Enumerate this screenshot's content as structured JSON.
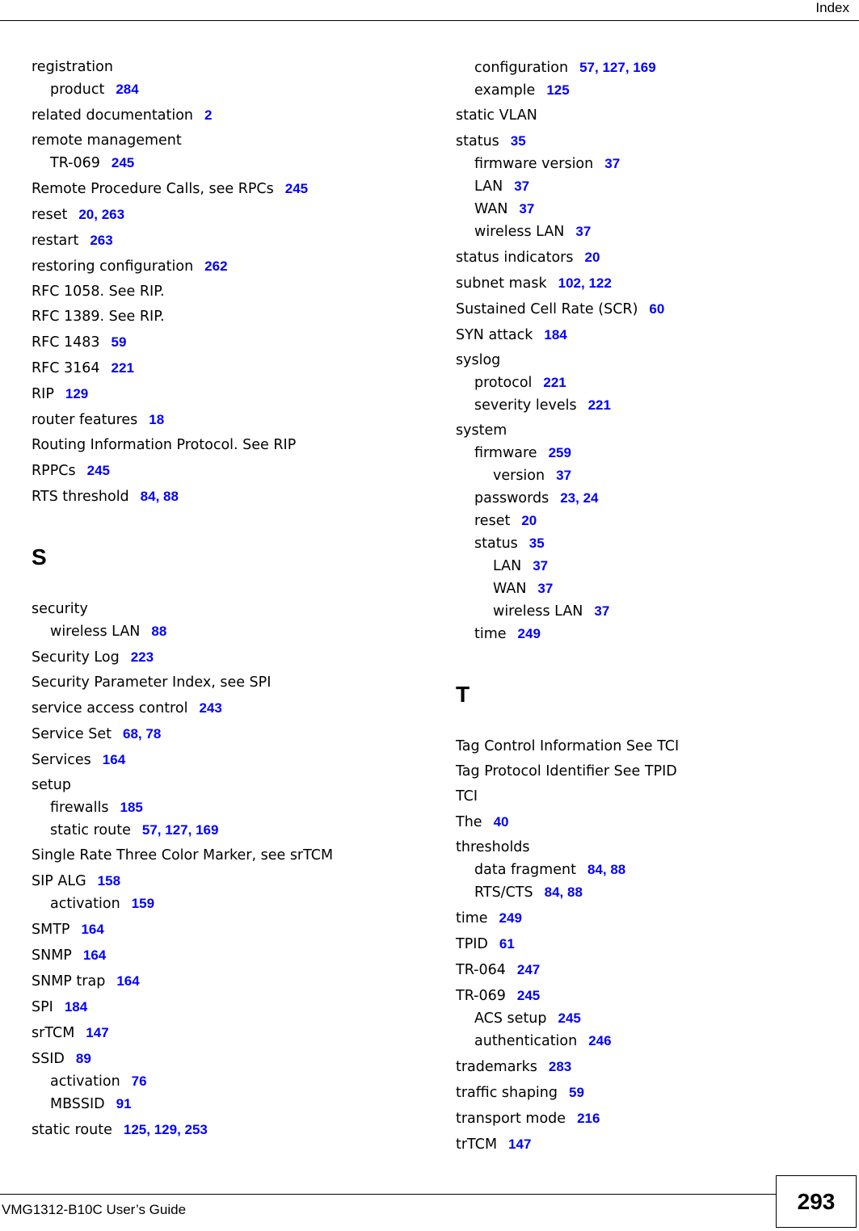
{
  "header": {
    "title": "Index"
  },
  "footer": {
    "guide_title": "VMG1312-B10C User’s Guide",
    "page_number": "293"
  },
  "colors": {
    "page_link": "#0000ff",
    "text": "#000000"
  },
  "columns": [
    {
      "blocks": [
        {
          "type": "entry",
          "level": 0,
          "text": "registration",
          "pages": []
        },
        {
          "type": "entry",
          "level": 1,
          "text": "product",
          "pages": [
            "284"
          ]
        },
        {
          "type": "entry",
          "level": 0,
          "text": "related documentation",
          "pages": [
            "2"
          ]
        },
        {
          "type": "entry",
          "level": 0,
          "text": "remote management",
          "pages": []
        },
        {
          "type": "entry",
          "level": 1,
          "text": "TR-069",
          "pages": [
            "245"
          ]
        },
        {
          "type": "entry",
          "level": 0,
          "text": "Remote Procedure Calls, see RPCs",
          "pages": [
            "245"
          ]
        },
        {
          "type": "entry",
          "level": 0,
          "text": "reset",
          "pages": [
            "20",
            "263"
          ]
        },
        {
          "type": "entry",
          "level": 0,
          "text": "restart",
          "pages": [
            "263"
          ]
        },
        {
          "type": "entry",
          "level": 0,
          "text": "restoring configuration",
          "pages": [
            "262"
          ]
        },
        {
          "type": "entry",
          "level": 0,
          "text": "RFC 1058. See RIP.",
          "pages": []
        },
        {
          "type": "entry",
          "level": 0,
          "text": "RFC 1389. See RIP.",
          "pages": []
        },
        {
          "type": "entry",
          "level": 0,
          "text": "RFC 1483",
          "pages": [
            "59"
          ]
        },
        {
          "type": "entry",
          "level": 0,
          "text": "RFC 3164",
          "pages": [
            "221"
          ]
        },
        {
          "type": "entry",
          "level": 0,
          "text": "RIP",
          "pages": [
            "129"
          ]
        },
        {
          "type": "entry",
          "level": 0,
          "text": "router features",
          "pages": [
            "18"
          ]
        },
        {
          "type": "entry",
          "level": 0,
          "text": "Routing Information Protocol. See RIP",
          "pages": []
        },
        {
          "type": "entry",
          "level": 0,
          "text": "RPPCs",
          "pages": [
            "245"
          ]
        },
        {
          "type": "entry",
          "level": 0,
          "text": "RTS threshold",
          "pages": [
            "84",
            "88"
          ]
        },
        {
          "type": "letter",
          "text": "S"
        },
        {
          "type": "entry",
          "level": 0,
          "text": "security",
          "pages": []
        },
        {
          "type": "entry",
          "level": 1,
          "text": "wireless LAN",
          "pages": [
            "88"
          ]
        },
        {
          "type": "entry",
          "level": 0,
          "text": "Security Log",
          "pages": [
            "223"
          ]
        },
        {
          "type": "entry",
          "level": 0,
          "text": "Security Parameter Index, see SPI",
          "pages": []
        },
        {
          "type": "entry",
          "level": 0,
          "text": "service access control",
          "pages": [
            "243"
          ]
        },
        {
          "type": "entry",
          "level": 0,
          "text": "Service Set",
          "pages": [
            "68",
            "78"
          ]
        },
        {
          "type": "entry",
          "level": 0,
          "text": "Services",
          "pages": [
            "164"
          ]
        },
        {
          "type": "entry",
          "level": 0,
          "text": "setup",
          "pages": []
        },
        {
          "type": "entry",
          "level": 1,
          "text": "firewalls",
          "pages": [
            "185"
          ]
        },
        {
          "type": "entry",
          "level": 1,
          "text": "static route",
          "pages": [
            "57",
            "127",
            "169"
          ]
        },
        {
          "type": "entry",
          "level": 0,
          "text": "Single Rate Three Color Marker, see srTCM",
          "pages": []
        },
        {
          "type": "entry",
          "level": 0,
          "text": "SIP ALG",
          "pages": [
            "158"
          ]
        },
        {
          "type": "entry",
          "level": 1,
          "text": "activation",
          "pages": [
            "159"
          ]
        },
        {
          "type": "entry",
          "level": 0,
          "text": "SMTP",
          "pages": [
            "164"
          ]
        },
        {
          "type": "entry",
          "level": 0,
          "text": "SNMP",
          "pages": [
            "164"
          ]
        },
        {
          "type": "entry",
          "level": 0,
          "text": "SNMP trap",
          "pages": [
            "164"
          ]
        },
        {
          "type": "entry",
          "level": 0,
          "text": "SPI",
          "pages": [
            "184"
          ]
        },
        {
          "type": "entry",
          "level": 0,
          "text": "srTCM",
          "pages": [
            "147"
          ]
        },
        {
          "type": "entry",
          "level": 0,
          "text": "SSID",
          "pages": [
            "89"
          ]
        },
        {
          "type": "entry",
          "level": 1,
          "text": "activation",
          "pages": [
            "76"
          ]
        },
        {
          "type": "entry",
          "level": 1,
          "text": "MBSSID",
          "pages": [
            "91"
          ]
        },
        {
          "type": "entry",
          "level": 0,
          "text": "static route",
          "pages": [
            "125",
            "129",
            "253"
          ]
        }
      ]
    },
    {
      "blocks": [
        {
          "type": "entry",
          "level": 1,
          "text": "configuration",
          "pages": [
            "57",
            "127",
            "169"
          ]
        },
        {
          "type": "entry",
          "level": 1,
          "text": "example",
          "pages": [
            "125"
          ]
        },
        {
          "type": "entry",
          "level": 0,
          "text": "static VLAN",
          "pages": []
        },
        {
          "type": "entry",
          "level": 0,
          "text": "status",
          "pages": [
            "35"
          ]
        },
        {
          "type": "entry",
          "level": 1,
          "text": "firmware version",
          "pages": [
            "37"
          ]
        },
        {
          "type": "entry",
          "level": 1,
          "text": "LAN",
          "pages": [
            "37"
          ]
        },
        {
          "type": "entry",
          "level": 1,
          "text": "WAN",
          "pages": [
            "37"
          ]
        },
        {
          "type": "entry",
          "level": 1,
          "text": "wireless LAN",
          "pages": [
            "37"
          ]
        },
        {
          "type": "entry",
          "level": 0,
          "text": "status indicators",
          "pages": [
            "20"
          ]
        },
        {
          "type": "entry",
          "level": 0,
          "text": "subnet mask",
          "pages": [
            "102",
            "122"
          ]
        },
        {
          "type": "entry",
          "level": 0,
          "text": "Sustained Cell Rate (SCR)",
          "pages": [
            "60"
          ]
        },
        {
          "type": "entry",
          "level": 0,
          "text": "SYN attack",
          "pages": [
            "184"
          ]
        },
        {
          "type": "entry",
          "level": 0,
          "text": "syslog",
          "pages": []
        },
        {
          "type": "entry",
          "level": 1,
          "text": "protocol",
          "pages": [
            "221"
          ]
        },
        {
          "type": "entry",
          "level": 1,
          "text": "severity levels",
          "pages": [
            "221"
          ]
        },
        {
          "type": "entry",
          "level": 0,
          "text": "system",
          "pages": []
        },
        {
          "type": "entry",
          "level": 1,
          "text": "firmware",
          "pages": [
            "259"
          ]
        },
        {
          "type": "entry",
          "level": 2,
          "text": "version",
          "pages": [
            "37"
          ]
        },
        {
          "type": "entry",
          "level": 1,
          "text": "passwords",
          "pages": [
            "23",
            "24"
          ]
        },
        {
          "type": "entry",
          "level": 1,
          "text": "reset",
          "pages": [
            "20"
          ]
        },
        {
          "type": "entry",
          "level": 1,
          "text": "status",
          "pages": [
            "35"
          ]
        },
        {
          "type": "entry",
          "level": 2,
          "text": "LAN",
          "pages": [
            "37"
          ]
        },
        {
          "type": "entry",
          "level": 2,
          "text": "WAN",
          "pages": [
            "37"
          ]
        },
        {
          "type": "entry",
          "level": 2,
          "text": "wireless LAN",
          "pages": [
            "37"
          ]
        },
        {
          "type": "entry",
          "level": 1,
          "text": "time",
          "pages": [
            "249"
          ]
        },
        {
          "type": "letter",
          "text": "T"
        },
        {
          "type": "entry",
          "level": 0,
          "text": "Tag Control Information See TCI",
          "pages": []
        },
        {
          "type": "entry",
          "level": 0,
          "text": "Tag Protocol Identifier See TPID",
          "pages": []
        },
        {
          "type": "entry",
          "level": 0,
          "text": "TCI",
          "pages": []
        },
        {
          "type": "entry",
          "level": 0,
          "text": "The",
          "pages": [
            "40"
          ]
        },
        {
          "type": "entry",
          "level": 0,
          "text": "thresholds",
          "pages": []
        },
        {
          "type": "entry",
          "level": 1,
          "text": "data fragment",
          "pages": [
            "84",
            "88"
          ]
        },
        {
          "type": "entry",
          "level": 1,
          "text": "RTS/CTS",
          "pages": [
            "84",
            "88"
          ]
        },
        {
          "type": "entry",
          "level": 0,
          "text": "time",
          "pages": [
            "249"
          ]
        },
        {
          "type": "entry",
          "level": 0,
          "text": "TPID",
          "pages": [
            "61"
          ]
        },
        {
          "type": "entry",
          "level": 0,
          "text": "TR-064",
          "pages": [
            "247"
          ]
        },
        {
          "type": "entry",
          "level": 0,
          "text": "TR-069",
          "pages": [
            "245"
          ]
        },
        {
          "type": "entry",
          "level": 1,
          "text": "ACS setup",
          "pages": [
            "245"
          ]
        },
        {
          "type": "entry",
          "level": 1,
          "text": "authentication",
          "pages": [
            "246"
          ]
        },
        {
          "type": "entry",
          "level": 0,
          "text": "trademarks",
          "pages": [
            "283"
          ]
        },
        {
          "type": "entry",
          "level": 0,
          "text": "traffic shaping",
          "pages": [
            "59"
          ]
        },
        {
          "type": "entry",
          "level": 0,
          "text": "transport mode",
          "pages": [
            "216"
          ]
        },
        {
          "type": "entry",
          "level": 0,
          "text": "trTCM",
          "pages": [
            "147"
          ]
        }
      ]
    }
  ]
}
